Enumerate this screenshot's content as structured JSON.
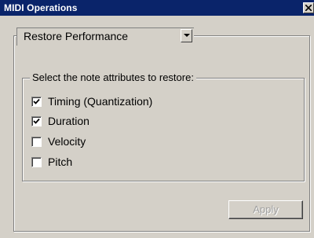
{
  "window": {
    "title": "MIDI Operations",
    "close_icon": "close-icon"
  },
  "operation": {
    "selected": "Restore Performance",
    "arrow_icon": "chevron-down-icon"
  },
  "attributes": {
    "legend": "Select the note attributes to restore:",
    "items": [
      {
        "label": "Timing (Quantization)",
        "checked": true
      },
      {
        "label": "Duration",
        "checked": true
      },
      {
        "label": "Velocity",
        "checked": false
      },
      {
        "label": "Pitch",
        "checked": false
      }
    ]
  },
  "actions": {
    "apply_label": "Apply",
    "apply_enabled": false
  },
  "colors": {
    "titlebar": "#0a246a",
    "face": "#d4d0c8",
    "disabled_text": "#a0a0a0"
  }
}
